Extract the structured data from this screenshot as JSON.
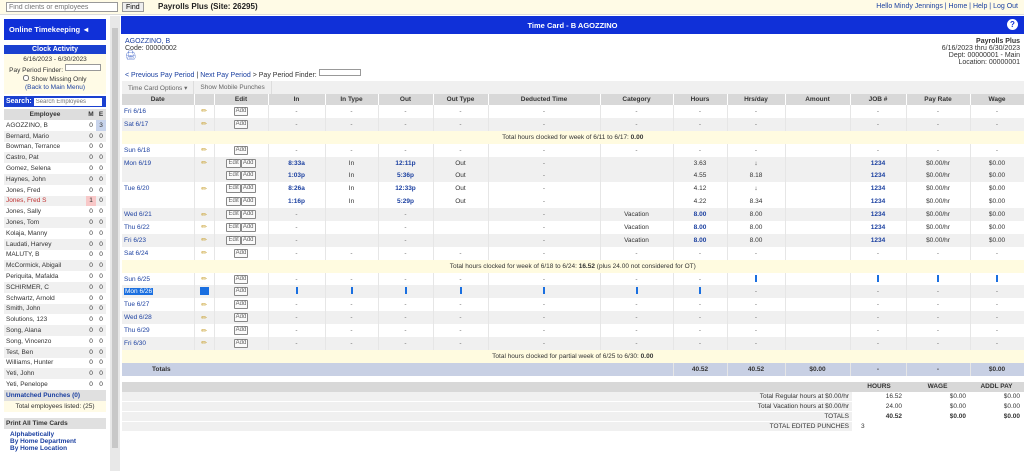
{
  "topbar": {
    "search_placeholder": "Find clients or employees",
    "find": "Find",
    "site": "Payrolls Plus (Site: 26295)",
    "hello": "Hello Mindy Jennings",
    "home": "Home",
    "help": "Help",
    "logout": "Log Out"
  },
  "sidebar": {
    "online": "Online Timekeeping ◄",
    "clock_activity": "Clock Activity",
    "period": "6/16/2023 - 6/30/2023",
    "finder": "Pay Period Finder:",
    "show_missing": "Show Missing Only",
    "back": "(Back to Main Menu)",
    "search_label": "Search:",
    "search_placeholder": "Search Employees",
    "col_employee": "Employee",
    "col_m": "M",
    "col_e": "E",
    "employees": [
      [
        "AGOZZINO, B",
        "0",
        "3"
      ],
      [
        "Bernard, Mario",
        "0",
        "0"
      ],
      [
        "Bowman, Terrance",
        "0",
        "0"
      ],
      [
        "Castro, Pat",
        "0",
        "0"
      ],
      [
        "Gomez, Selena",
        "0",
        "0"
      ],
      [
        "Haynes, John",
        "0",
        "0"
      ],
      [
        "Jones, Fred",
        "0",
        "0"
      ],
      [
        "Jones, Fred S",
        "1",
        "0"
      ],
      [
        "Jones, Sally",
        "0",
        "0"
      ],
      [
        "Jones, Tom",
        "0",
        "0"
      ],
      [
        "Kolaja, Manny",
        "0",
        "0"
      ],
      [
        "Laudati, Harvey",
        "0",
        "0"
      ],
      [
        "MALUTY, B",
        "0",
        "0"
      ],
      [
        "McCormick, Abigail",
        "0",
        "0"
      ],
      [
        "Periquita, Mafalda",
        "0",
        "0"
      ],
      [
        "SCHIRMER, C",
        "0",
        "0"
      ],
      [
        "Schwartz, Arnold",
        "0",
        "0"
      ],
      [
        "Smith, John",
        "0",
        "0"
      ],
      [
        "Solutions, 123",
        "0",
        "0"
      ],
      [
        "Song, Alana",
        "0",
        "0"
      ],
      [
        "Song, Vincenzo",
        "0",
        "0"
      ],
      [
        "Test, Ben",
        "0",
        "0"
      ],
      [
        "Williams, Hunter",
        "0",
        "0"
      ],
      [
        "Yeti, John",
        "0",
        "0"
      ],
      [
        "Yeti, Penelope",
        "0",
        "0"
      ]
    ],
    "unmatched": "Unmatched Punches (0)",
    "total_listed": "Total employees listed: (25)",
    "print_all": "Print All Time Cards",
    "print_links": [
      "Alphabetically",
      "By Home Department",
      "By Home Location"
    ]
  },
  "main": {
    "title": "Time Card - B AGOZZINO",
    "help": "?",
    "emp_name": "AGOZZINO, B",
    "code": "Code: 00000002",
    "prev": "< Previous Pay Period",
    "sep": "|",
    "next": "Next Pay Period",
    "finder": "> Pay Period Finder:",
    "company": "Payrolls Plus",
    "range": "6/16/2023 thru 6/30/2023",
    "dept": "Dept: 00000001 - Main",
    "location": "Location: 00000001",
    "options": "Time Card Options ▾",
    "mobile": "Show Mobile Punches",
    "columns": [
      "Date",
      "",
      "Edit",
      "In",
      "In Type",
      "Out",
      "Out Type",
      "Deducted Time",
      "Category",
      "Hours",
      "Hrs/day",
      "Amount",
      "JOB #",
      "Pay Rate",
      "Wage"
    ],
    "rows": [
      {
        "date": "Fri 6/16",
        "pen": 1,
        "edit": 0,
        "v": [
          "-",
          "-",
          "-",
          "-",
          "-",
          "-",
          "-",
          "-",
          "",
          "-",
          "-",
          "-"
        ]
      },
      {
        "date": "Sat 6/17",
        "pen": 1,
        "edit": 0,
        "v": [
          "-",
          "-",
          "-",
          "-",
          "-",
          "-",
          "-",
          "-",
          "",
          "-",
          "-",
          "-"
        ]
      },
      {
        "summary": "Total hours clocked for week of 6/11 to 6/17: ",
        "bold": "0.00",
        "extra": ""
      },
      {
        "date": "Sun 6/18",
        "pen": 1,
        "edit": 0,
        "v": [
          "-",
          "-",
          "-",
          "-",
          "-",
          "-",
          "-",
          "-",
          "",
          "-",
          "-",
          "-"
        ]
      },
      {
        "date": "Mon 6/19",
        "pen": 1,
        "edit": 1,
        "v": [
          "8:33a",
          "In",
          "12:11p",
          "Out",
          "-",
          "",
          "3.63",
          "↓",
          "",
          "1234",
          "$0.00/hr",
          "$0.00"
        ]
      },
      {
        "date": "",
        "pen": 0,
        "edit": 1,
        "v": [
          "1:03p",
          "In",
          "5:36p",
          "Out",
          "-",
          "",
          "4.55",
          "8.18",
          "",
          "1234",
          "$0.00/hr",
          "$0.00"
        ]
      },
      {
        "date": "Tue 6/20",
        "pen": 1,
        "edit": 1,
        "v": [
          "8:26a",
          "In",
          "12:33p",
          "Out",
          "-",
          "",
          "4.12",
          "↓",
          "",
          "1234",
          "$0.00/hr",
          "$0.00"
        ]
      },
      {
        "date": "",
        "pen": 0,
        "edit": 1,
        "v": [
          "1:16p",
          "In",
          "5:29p",
          "Out",
          "-",
          "",
          "4.22",
          "8.34",
          "",
          "1234",
          "$0.00/hr",
          "$0.00"
        ]
      },
      {
        "date": "Wed 6/21",
        "pen": 1,
        "edit": 1,
        "v": [
          "-",
          "",
          "-",
          "",
          "-",
          "Vacation",
          "8.00",
          "8.00",
          "",
          "1234",
          "$0.00/hr",
          "$0.00"
        ]
      },
      {
        "date": "Thu 6/22",
        "pen": 1,
        "edit": 1,
        "v": [
          "-",
          "",
          "-",
          "",
          "-",
          "Vacation",
          "8.00",
          "8.00",
          "",
          "1234",
          "$0.00/hr",
          "$0.00"
        ]
      },
      {
        "date": "Fri 6/23",
        "pen": 1,
        "edit": 1,
        "v": [
          "-",
          "",
          "-",
          "",
          "-",
          "Vacation",
          "8.00",
          "8.00",
          "",
          "1234",
          "$0.00/hr",
          "$0.00"
        ]
      },
      {
        "date": "Sat 6/24",
        "pen": 1,
        "edit": 0,
        "v": [
          "-",
          "-",
          "-",
          "-",
          "-",
          "-",
          "-",
          "-",
          "",
          "-",
          "-",
          "-"
        ]
      },
      {
        "summary": "Total hours clocked for week of 6/18 to 6/24: ",
        "bold": "16.52",
        "extra": " (plus 24.00 not considered for OT)"
      },
      {
        "date": "Sun 6/25",
        "pen": 1,
        "edit": 0,
        "v": [
          "-",
          "-",
          "-",
          "-",
          "-",
          "-",
          "-",
          "|",
          "",
          "|",
          "|",
          "|"
        ]
      },
      {
        "date": "Mon 6/26",
        "pen": 2,
        "edit": 0,
        "v": [
          "|",
          "|",
          "|",
          "|",
          "|",
          "|",
          "|",
          "-",
          "",
          "-",
          "-",
          "-"
        ]
      },
      {
        "date": "Tue 6/27",
        "pen": 1,
        "edit": 0,
        "v": [
          "-",
          "-",
          "-",
          "-",
          "-",
          "-",
          "-",
          "-",
          "",
          "-",
          "-",
          "-"
        ]
      },
      {
        "date": "Wed 6/28",
        "pen": 1,
        "edit": 0,
        "v": [
          "-",
          "-",
          "-",
          "-",
          "-",
          "-",
          "-",
          "-",
          "",
          "-",
          "-",
          "-"
        ]
      },
      {
        "date": "Thu 6/29",
        "pen": 1,
        "edit": 0,
        "v": [
          "-",
          "-",
          "-",
          "-",
          "-",
          "-",
          "-",
          "-",
          "",
          "-",
          "-",
          "-"
        ]
      },
      {
        "date": "Fri 6/30",
        "pen": 1,
        "edit": 0,
        "v": [
          "-",
          "-",
          "-",
          "-",
          "-",
          "-",
          "-",
          "-",
          "",
          "-",
          "-",
          "-"
        ]
      },
      {
        "summary": "Total hours clocked for partial week of 6/25 to 6/30: ",
        "bold": "0.00",
        "extra": ""
      }
    ],
    "totals": {
      "label": "Totals",
      "hours": "40.52",
      "hrsday": "40.52",
      "amount": "$0.00",
      "job": "-",
      "rate": "-",
      "wage": "$0.00"
    },
    "edit_label": "Edit",
    "add_label": "Add",
    "summary": {
      "cols": [
        "HOURS",
        "WAGE",
        "ADDL PAY"
      ],
      "rows": [
        [
          "Total Regular hours at $0.00/hr",
          "16.52",
          "$0.00",
          "$0.00"
        ],
        [
          "Total Vacation hours at $0.00/hr",
          "24.00",
          "$0.00",
          "$0.00"
        ],
        [
          "TOTALS",
          "40.52",
          "$0.00",
          "$0.00"
        ],
        [
          "TOTAL EDITED PUNCHES",
          "3",
          "",
          ""
        ]
      ]
    }
  }
}
